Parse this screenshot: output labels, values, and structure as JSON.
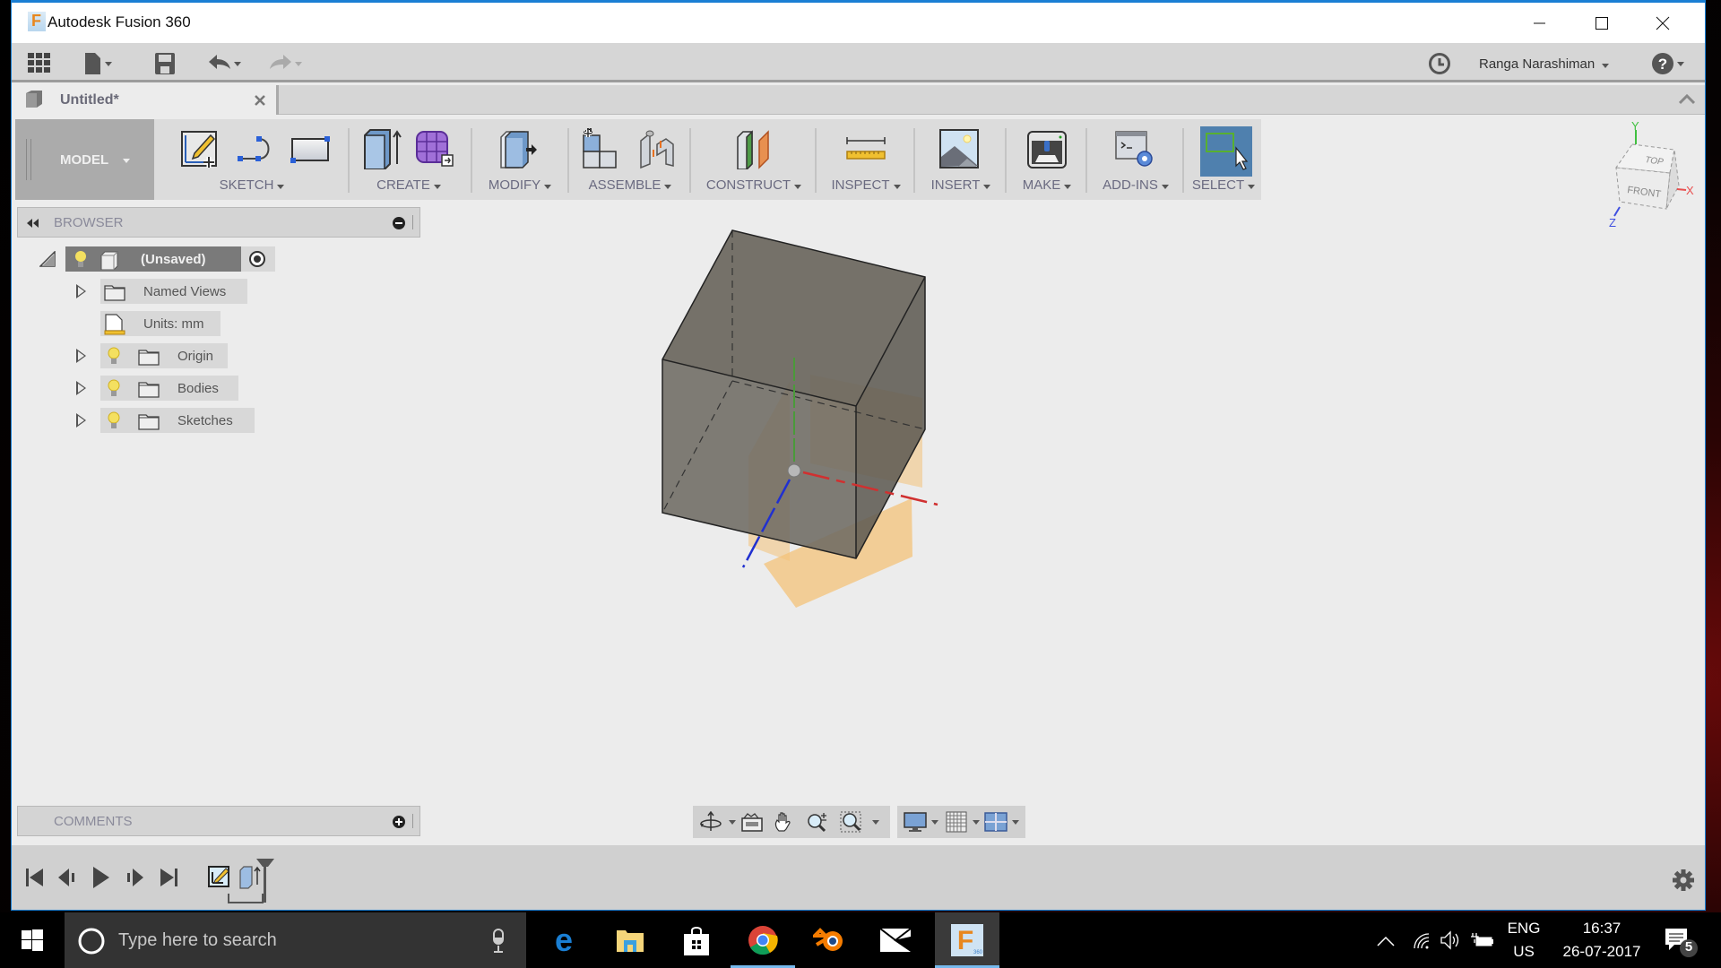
{
  "window": {
    "title": "Autodesk Fusion 360",
    "controls": [
      "minimize",
      "maximize",
      "close"
    ]
  },
  "quick_access": {
    "icons": [
      "data-panel-icon",
      "file-menu-icon",
      "save-icon",
      "undo-icon",
      "redo-icon"
    ],
    "user_name": "Ranga Narashiman",
    "job_status_icon": "clock-icon",
    "help_icon": "help-icon"
  },
  "document_tab": {
    "label": "Untitled*",
    "close_label": "×"
  },
  "toolbar": {
    "workspace": "MODEL",
    "groups": [
      {
        "label": "SKETCH",
        "icons": [
          "create-sketch-icon",
          "spline-icon",
          "rectangle-icon"
        ]
      },
      {
        "label": "CREATE",
        "icons": [
          "extrude-icon",
          "create-form-icon"
        ]
      },
      {
        "label": "MODIFY",
        "icons": [
          "press-pull-icon"
        ]
      },
      {
        "label": "ASSEMBLE",
        "icons": [
          "new-component-icon",
          "joint-icon"
        ]
      },
      {
        "label": "CONSTRUCT",
        "icons": [
          "offset-plane-icon"
        ]
      },
      {
        "label": "INSPECT",
        "icons": [
          "measure-icon"
        ]
      },
      {
        "label": "INSERT",
        "icons": [
          "insert-image-icon"
        ]
      },
      {
        "label": "MAKE",
        "icons": [
          "3d-print-icon"
        ]
      },
      {
        "label": "ADD-INS",
        "icons": [
          "scripts-addins-icon"
        ]
      },
      {
        "label": "SELECT",
        "icons": [
          "window-select-icon"
        ],
        "active": true
      }
    ]
  },
  "browser": {
    "title": "BROWSER",
    "root": {
      "label": "(Unsaved)"
    },
    "items": [
      {
        "label": "Named Views",
        "expandable": true,
        "visibility": false
      },
      {
        "label": "Units: mm",
        "expandable": false,
        "visibility": false
      },
      {
        "label": "Origin",
        "expandable": true,
        "visibility": true
      },
      {
        "label": "Bodies",
        "expandable": true,
        "visibility": true
      },
      {
        "label": "Sketches",
        "expandable": true,
        "visibility": true
      }
    ]
  },
  "viewcube": {
    "faces": [
      "TOP",
      "FRONT"
    ],
    "axes": {
      "x": "X",
      "y": "Y",
      "z": "Z"
    },
    "colors": {
      "x": "#e85050",
      "y": "#40c040",
      "z": "#4050e0"
    }
  },
  "comments": {
    "title": "COMMENTS"
  },
  "navigation_bar": {
    "icons": [
      "orbit-icon",
      "look-at-icon",
      "pan-icon",
      "zoom-icon",
      "fit-icon",
      "display-settings-icon",
      "grid-settings-icon",
      "viewports-icon"
    ]
  },
  "timeline": {
    "controls": [
      "go-to-start",
      "step-back",
      "play",
      "step-forward",
      "go-to-end"
    ],
    "features": [
      "sketch-feature",
      "extrude-feature"
    ]
  },
  "taskbar": {
    "search_placeholder": "Type here to search",
    "apps": [
      "edge",
      "file-explorer",
      "store",
      "chrome",
      "blender",
      "mail",
      "fusion-360"
    ],
    "language_top": "ENG",
    "language_bottom": "US",
    "time": "16:37",
    "date": "26-07-2017",
    "notification_count": "5"
  },
  "colors": {
    "accent": "#1a7fd4",
    "select_active": "#4f80ae",
    "body_fill": "#5d5a52",
    "plane_fill": "#f4c37a"
  }
}
